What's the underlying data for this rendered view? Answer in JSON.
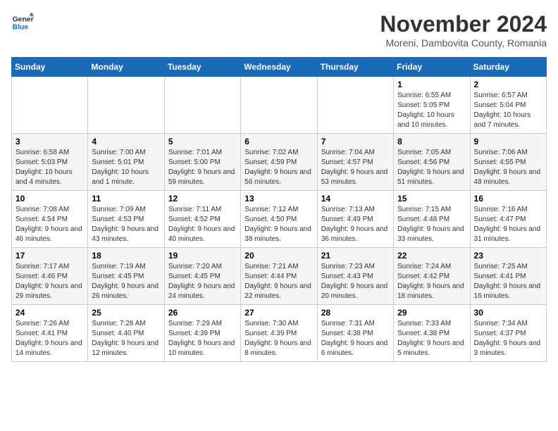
{
  "logo": {
    "line1": "General",
    "line2": "Blue"
  },
  "title": "November 2024",
  "subtitle": "Moreni, Dambovita County, Romania",
  "weekdays": [
    "Sunday",
    "Monday",
    "Tuesday",
    "Wednesday",
    "Thursday",
    "Friday",
    "Saturday"
  ],
  "weeks": [
    [
      {
        "day": "",
        "info": ""
      },
      {
        "day": "",
        "info": ""
      },
      {
        "day": "",
        "info": ""
      },
      {
        "day": "",
        "info": ""
      },
      {
        "day": "",
        "info": ""
      },
      {
        "day": "1",
        "info": "Sunrise: 6:55 AM\nSunset: 5:05 PM\nDaylight: 10 hours and 10 minutes."
      },
      {
        "day": "2",
        "info": "Sunrise: 6:57 AM\nSunset: 5:04 PM\nDaylight: 10 hours and 7 minutes."
      }
    ],
    [
      {
        "day": "3",
        "info": "Sunrise: 6:58 AM\nSunset: 5:03 PM\nDaylight: 10 hours and 4 minutes."
      },
      {
        "day": "4",
        "info": "Sunrise: 7:00 AM\nSunset: 5:01 PM\nDaylight: 10 hours and 1 minute."
      },
      {
        "day": "5",
        "info": "Sunrise: 7:01 AM\nSunset: 5:00 PM\nDaylight: 9 hours and 59 minutes."
      },
      {
        "day": "6",
        "info": "Sunrise: 7:02 AM\nSunset: 4:59 PM\nDaylight: 9 hours and 56 minutes."
      },
      {
        "day": "7",
        "info": "Sunrise: 7:04 AM\nSunset: 4:57 PM\nDaylight: 9 hours and 53 minutes."
      },
      {
        "day": "8",
        "info": "Sunrise: 7:05 AM\nSunset: 4:56 PM\nDaylight: 9 hours and 51 minutes."
      },
      {
        "day": "9",
        "info": "Sunrise: 7:06 AM\nSunset: 4:55 PM\nDaylight: 9 hours and 48 minutes."
      }
    ],
    [
      {
        "day": "10",
        "info": "Sunrise: 7:08 AM\nSunset: 4:54 PM\nDaylight: 9 hours and 46 minutes."
      },
      {
        "day": "11",
        "info": "Sunrise: 7:09 AM\nSunset: 4:53 PM\nDaylight: 9 hours and 43 minutes."
      },
      {
        "day": "12",
        "info": "Sunrise: 7:11 AM\nSunset: 4:52 PM\nDaylight: 9 hours and 40 minutes."
      },
      {
        "day": "13",
        "info": "Sunrise: 7:12 AM\nSunset: 4:50 PM\nDaylight: 9 hours and 38 minutes."
      },
      {
        "day": "14",
        "info": "Sunrise: 7:13 AM\nSunset: 4:49 PM\nDaylight: 9 hours and 36 minutes."
      },
      {
        "day": "15",
        "info": "Sunrise: 7:15 AM\nSunset: 4:48 PM\nDaylight: 9 hours and 33 minutes."
      },
      {
        "day": "16",
        "info": "Sunrise: 7:16 AM\nSunset: 4:47 PM\nDaylight: 9 hours and 31 minutes."
      }
    ],
    [
      {
        "day": "17",
        "info": "Sunrise: 7:17 AM\nSunset: 4:46 PM\nDaylight: 9 hours and 29 minutes."
      },
      {
        "day": "18",
        "info": "Sunrise: 7:19 AM\nSunset: 4:45 PM\nDaylight: 9 hours and 26 minutes."
      },
      {
        "day": "19",
        "info": "Sunrise: 7:20 AM\nSunset: 4:45 PM\nDaylight: 9 hours and 24 minutes."
      },
      {
        "day": "20",
        "info": "Sunrise: 7:21 AM\nSunset: 4:44 PM\nDaylight: 9 hours and 22 minutes."
      },
      {
        "day": "21",
        "info": "Sunrise: 7:23 AM\nSunset: 4:43 PM\nDaylight: 9 hours and 20 minutes."
      },
      {
        "day": "22",
        "info": "Sunrise: 7:24 AM\nSunset: 4:42 PM\nDaylight: 9 hours and 18 minutes."
      },
      {
        "day": "23",
        "info": "Sunrise: 7:25 AM\nSunset: 4:41 PM\nDaylight: 9 hours and 16 minutes."
      }
    ],
    [
      {
        "day": "24",
        "info": "Sunrise: 7:26 AM\nSunset: 4:41 PM\nDaylight: 9 hours and 14 minutes."
      },
      {
        "day": "25",
        "info": "Sunrise: 7:28 AM\nSunset: 4:40 PM\nDaylight: 9 hours and 12 minutes."
      },
      {
        "day": "26",
        "info": "Sunrise: 7:29 AM\nSunset: 4:39 PM\nDaylight: 9 hours and 10 minutes."
      },
      {
        "day": "27",
        "info": "Sunrise: 7:30 AM\nSunset: 4:39 PM\nDaylight: 9 hours and 8 minutes."
      },
      {
        "day": "28",
        "info": "Sunrise: 7:31 AM\nSunset: 4:38 PM\nDaylight: 9 hours and 6 minutes."
      },
      {
        "day": "29",
        "info": "Sunrise: 7:33 AM\nSunset: 4:38 PM\nDaylight: 9 hours and 5 minutes."
      },
      {
        "day": "30",
        "info": "Sunrise: 7:34 AM\nSunset: 4:37 PM\nDaylight: 9 hours and 3 minutes."
      }
    ]
  ]
}
